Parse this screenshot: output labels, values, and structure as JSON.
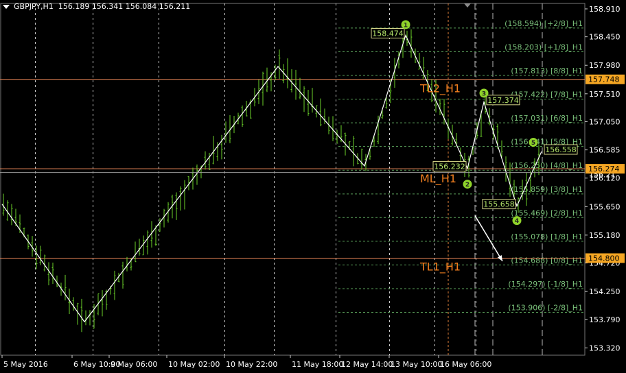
{
  "header": {
    "symbol": "GBPJPY,H1",
    "ohlc": "156.189 156.341 156.084 156.211"
  },
  "colors": {
    "background": "#000000",
    "candle": "#6cd22a",
    "zigzag": "#ffffff",
    "trendline": "#f08a5a",
    "grid": "#c8c8c8",
    "murrey": "#5aa05a",
    "murrey_text": "#7ac07a",
    "badge": "#f5a623",
    "label_orange": "#f07e1e",
    "point_marker": "#8fd32a"
  },
  "chart_data": {
    "type": "candlestick",
    "symbol": "GBPJPY",
    "timeframe": "H1",
    "ylim": [
      153.2,
      159.0
    ],
    "y_ticks": [
      158.91,
      158.45,
      157.98,
      157.51,
      157.05,
      156.585,
      156.12,
      155.65,
      155.18,
      154.72,
      154.25,
      153.79,
      153.32
    ],
    "x_tick_labels": [
      "5 May 2016",
      "6 May 10:00",
      "9 May 06:00",
      "10 May 02:00",
      "10 May 22:00",
      "11 May 18:00",
      "12 May 14:00",
      "13 May 10:00",
      "16 May 06:00"
    ],
    "zigzag": [
      {
        "x": 0,
        "y": 155.69
      },
      {
        "x": 20,
        "y": 153.75
      },
      {
        "x": 67,
        "y": 157.96
      },
      {
        "x": 88,
        "y": 156.32
      },
      {
        "x": 98,
        "y": 158.474
      },
      {
        "x": 113,
        "y": 156.28
      },
      {
        "x": 117,
        "y": 157.374
      },
      {
        "x": 125,
        "y": 155.658
      },
      {
        "x": 131,
        "y": 156.558
      }
    ],
    "price_labels": [
      {
        "x": 98,
        "y": 158.474,
        "text": "158.474",
        "side": "left"
      },
      {
        "x": 117,
        "y": 157.374,
        "text": "157.374",
        "side": "right"
      },
      {
        "x": 113,
        "y": 156.28,
        "text": "156.232",
        "side": "left"
      },
      {
        "x": 125,
        "y": 155.658,
        "text": "155.658",
        "side": "left"
      },
      {
        "x": 131,
        "y": 156.558,
        "text": "156.558",
        "side": "right"
      }
    ],
    "points": [
      {
        "n": "1",
        "x": 98,
        "y": 158.65
      },
      {
        "n": "2",
        "x": 113,
        "y": 156.02
      },
      {
        "n": "3",
        "x": 117,
        "y": 157.52
      },
      {
        "n": "4",
        "x": 125,
        "y": 155.42
      },
      {
        "n": "5",
        "x": 129,
        "y": 156.71
      }
    ],
    "hlines": [
      {
        "name": "TL2_H1",
        "y": 157.748,
        "badge": "157.748"
      },
      {
        "name": "ML_H1",
        "y": 156.274,
        "badge": "156.274"
      },
      {
        "name": "TL1_H1",
        "y": 154.8,
        "badge": "154.800"
      }
    ],
    "current_price": 156.211,
    "current_price_tick": "156.21",
    "murrey_levels": [
      {
        "price": 158.594,
        "label": "(158.594) [+2/8]_H1"
      },
      {
        "price": 158.203,
        "label": "(158.203) [+1/8]_H1"
      },
      {
        "price": 157.813,
        "label": "(157.813) [8/8]_H1"
      },
      {
        "price": 157.422,
        "label": "(157.422) [7/8]_H1"
      },
      {
        "price": 157.031,
        "label": "(157.031) [6/8]_H1"
      },
      {
        "price": 156.641,
        "label": "(156.641) [5/8]_H1"
      },
      {
        "price": 156.25,
        "label": "(156.250) [4/8]_H1"
      },
      {
        "price": 155.859,
        "label": "(155.859) [3/8]_H1"
      },
      {
        "price": 155.469,
        "label": "(155.469) [2/8]_H1"
      },
      {
        "price": 155.078,
        "label": "(155.078) [1/8]_H1"
      },
      {
        "price": 154.688,
        "label": "(154.688) [0/8]_H1"
      },
      {
        "price": 154.297,
        "label": "(154.297) [-1/8]_H1"
      },
      {
        "price": 153.906,
        "label": "(153.906) [-2/8]_H1"
      }
    ],
    "arrow": {
      "from": {
        "x": 135,
        "y": 155.5
      },
      "to": {
        "x": 142,
        "y": 154.75
      }
    }
  }
}
